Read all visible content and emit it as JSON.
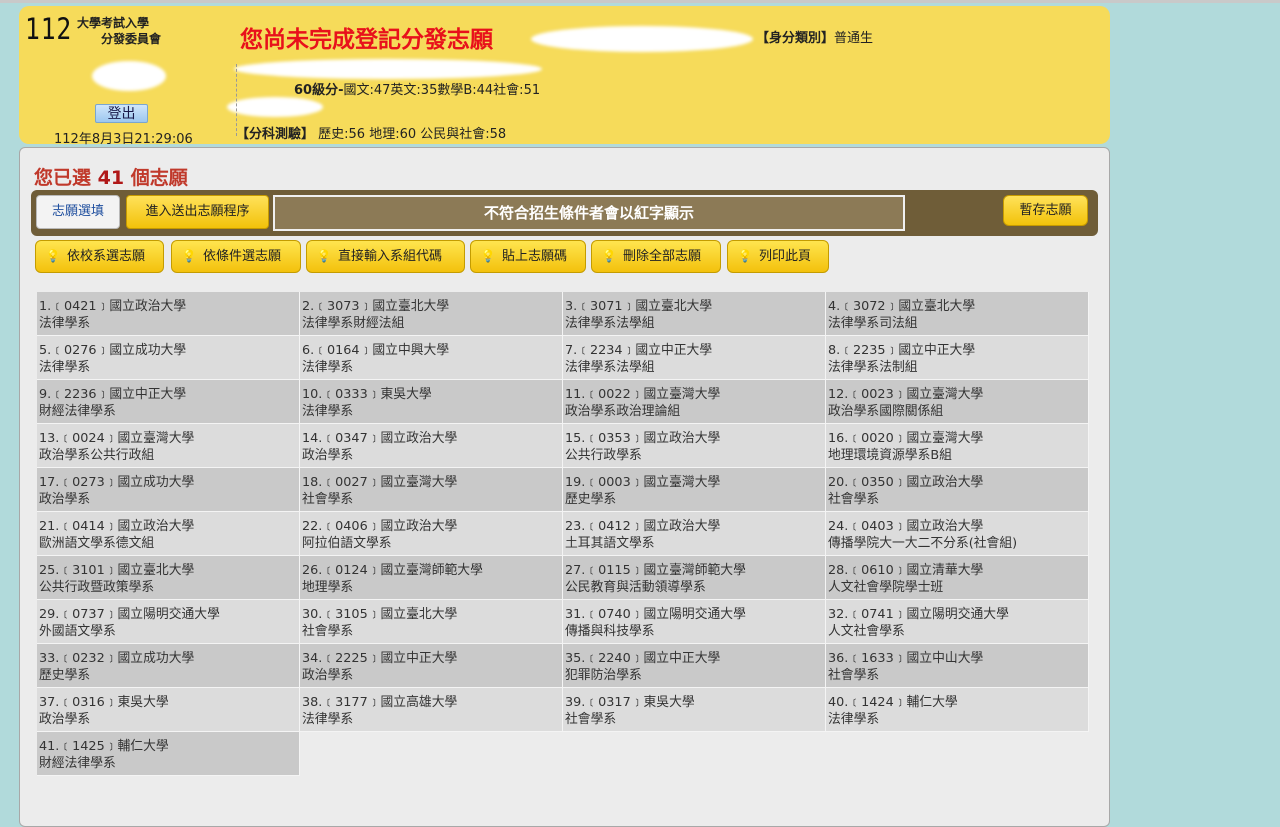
{
  "header": {
    "logo_number": "112",
    "logo_line1": "大學考試入學",
    "logo_line2": "分發委員會",
    "warning": "您尚未完成登記分發志願",
    "identity_label": "【身分類別】",
    "identity_value": "普通生",
    "logout_label": "登出",
    "datetime": "112年8月3日21:29:06",
    "score_level_label": "60級分-",
    "score_level_detail": "國文:47英文:35數學B:44社會:51",
    "subject_test_label": "【分科測驗】",
    "subject_test_detail": "歷史:56 地理:60 公民與社會:58"
  },
  "main": {
    "selected_prefix": "您已選",
    "selected_count": "41",
    "selected_suffix": "個志願",
    "tab_fill": "志願選填",
    "tab_send": "進入送出志願程序",
    "notice": "不符合招生條件者會以紅字顯示",
    "save_button": "暫存志願",
    "actions": [
      {
        "label": "依校系選志願",
        "icon": "lightbulb-icon"
      },
      {
        "label": "依條件選志願",
        "icon": "lightbulb-icon"
      },
      {
        "label": "直接輸入系組代碼",
        "icon": "lightbulb-icon"
      },
      {
        "label": "貼上志願碼",
        "icon": "lightbulb-icon"
      },
      {
        "label": "刪除全部志願",
        "icon": "lightbulb-icon"
      },
      {
        "label": "列印此頁",
        "icon": "lightbulb-icon"
      }
    ]
  },
  "choices": [
    {
      "line1": "1.﹝0421﹞國立政治大學",
      "line2": "法律學系"
    },
    {
      "line1": "2.﹝3073﹞國立臺北大學",
      "line2": "法律學系財經法組"
    },
    {
      "line1": "3.﹝3071﹞國立臺北大學",
      "line2": "法律學系法學組"
    },
    {
      "line1": "4.﹝3072﹞國立臺北大學",
      "line2": "法律學系司法組"
    },
    {
      "line1": "5.﹝0276﹞國立成功大學",
      "line2": "法律學系"
    },
    {
      "line1": "6.﹝0164﹞國立中興大學",
      "line2": "法律學系"
    },
    {
      "line1": "7.﹝2234﹞國立中正大學",
      "line2": "法律學系法學組"
    },
    {
      "line1": "8.﹝2235﹞國立中正大學",
      "line2": "法律學系法制組"
    },
    {
      "line1": "9.﹝2236﹞國立中正大學",
      "line2": "財經法律學系"
    },
    {
      "line1": "10.﹝0333﹞東吳大學",
      "line2": "法律學系"
    },
    {
      "line1": "11.﹝0022﹞國立臺灣大學",
      "line2": "政治學系政治理論組"
    },
    {
      "line1": "12.﹝0023﹞國立臺灣大學",
      "line2": "政治學系國際關係組"
    },
    {
      "line1": "13.﹝0024﹞國立臺灣大學",
      "line2": "政治學系公共行政組"
    },
    {
      "line1": "14.﹝0347﹞國立政治大學",
      "line2": "政治學系"
    },
    {
      "line1": "15.﹝0353﹞國立政治大學",
      "line2": "公共行政學系"
    },
    {
      "line1": "16.﹝0020﹞國立臺灣大學",
      "line2": "地理環境資源學系B組"
    },
    {
      "line1": "17.﹝0273﹞國立成功大學",
      "line2": "政治學系"
    },
    {
      "line1": "18.﹝0027﹞國立臺灣大學",
      "line2": "社會學系"
    },
    {
      "line1": "19.﹝0003﹞國立臺灣大學",
      "line2": "歷史學系"
    },
    {
      "line1": "20.﹝0350﹞國立政治大學",
      "line2": "社會學系"
    },
    {
      "line1": "21.﹝0414﹞國立政治大學",
      "line2": "歐洲語文學系德文組"
    },
    {
      "line1": "22.﹝0406﹞國立政治大學",
      "line2": "阿拉伯語文學系"
    },
    {
      "line1": "23.﹝0412﹞國立政治大學",
      "line2": "土耳其語文學系"
    },
    {
      "line1": "24.﹝0403﹞國立政治大學",
      "line2": "傳播學院大一大二不分系(社會組)"
    },
    {
      "line1": "25.﹝3101﹞國立臺北大學",
      "line2": "公共行政暨政策學系"
    },
    {
      "line1": "26.﹝0124﹞國立臺灣師範大學",
      "line2": "地理學系"
    },
    {
      "line1": "27.﹝0115﹞國立臺灣師範大學",
      "line2": "公民教育與活動領導學系"
    },
    {
      "line1": "28.﹝0610﹞國立清華大學",
      "line2": "人文社會學院學士班"
    },
    {
      "line1": "29.﹝0737﹞國立陽明交通大學",
      "line2": "外國語文學系"
    },
    {
      "line1": "30.﹝3105﹞國立臺北大學",
      "line2": "社會學系"
    },
    {
      "line1": "31.﹝0740﹞國立陽明交通大學",
      "line2": "傳播與科技學系"
    },
    {
      "line1": "32.﹝0741﹞國立陽明交通大學",
      "line2": "人文社會學系"
    },
    {
      "line1": "33.﹝0232﹞國立成功大學",
      "line2": "歷史學系"
    },
    {
      "line1": "34.﹝2225﹞國立中正大學",
      "line2": "政治學系"
    },
    {
      "line1": "35.﹝2240﹞國立中正大學",
      "line2": "犯罪防治學系"
    },
    {
      "line1": "36.﹝1633﹞國立中山大學",
      "line2": "社會學系"
    },
    {
      "line1": "37.﹝0316﹞東吳大學",
      "line2": "政治學系"
    },
    {
      "line1": "38.﹝3177﹞國立高雄大學",
      "line2": "法律學系"
    },
    {
      "line1": "39.﹝0317﹞東吳大學",
      "line2": "社會學系"
    },
    {
      "line1": "40.﹝1424﹞輔仁大學",
      "line2": "法律學系"
    },
    {
      "line1": "41.﹝1425﹞輔仁大學",
      "line2": "財經法律學系"
    }
  ]
}
